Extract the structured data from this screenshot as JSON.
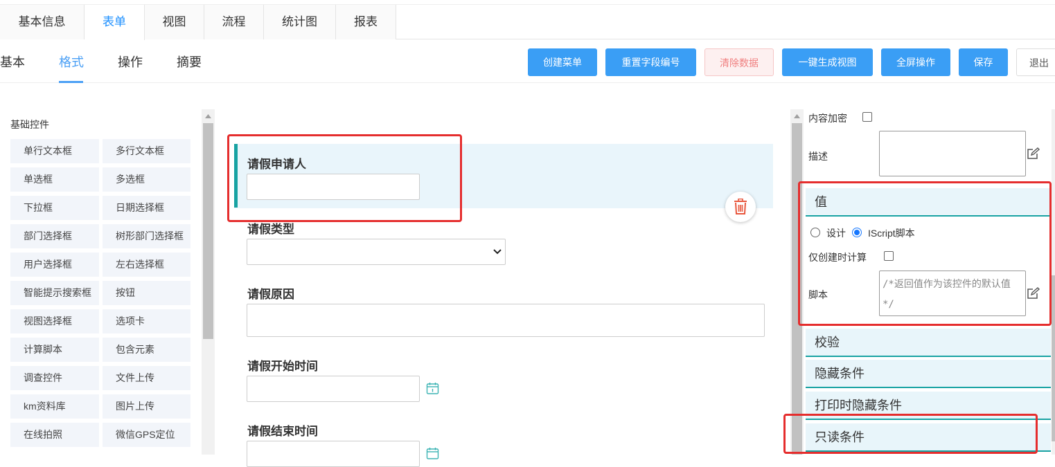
{
  "top_tabs": [
    "基本信息",
    "表单",
    "视图",
    "流程",
    "统计图",
    "报表"
  ],
  "sub_tabs": [
    "基本",
    "格式",
    "操作",
    "摘要"
  ],
  "toolbar": {
    "create_menu": "创建菜单",
    "reset_field_no": "重置字段编号",
    "clear_data": "清除数据",
    "generate_view": "一键生成视图",
    "fullscreen": "全屏操作",
    "save": "保存",
    "exit": "退出"
  },
  "palette": {
    "title": "基础控件",
    "items": [
      "单行文本框",
      "多行文本框",
      "单选框",
      "多选框",
      "下拉框",
      "日期选择框",
      "部门选择框",
      "树形部门选择框",
      "用户选择框",
      "左右选择框",
      "智能提示搜索框",
      "按钮",
      "视图选择框",
      "选项卡",
      "计算脚本",
      "包含元素",
      "调查控件",
      "文件上传",
      "km资料库",
      "图片上传",
      "在线拍照",
      "微信GPS定位"
    ]
  },
  "form": {
    "applicant_label": "请假申请人",
    "type_label": "请假类型",
    "reason_label": "请假原因",
    "start_label": "请假开始时间",
    "end_label": "请假结束时间"
  },
  "props": {
    "encrypt_label": "内容加密",
    "desc_label": "描述",
    "value_section": "值",
    "radio_design": "设计",
    "radio_script": "IScript脚本",
    "create_only": "仅创建时计算",
    "script_label": "脚本",
    "script_placeholder": "/*返回值作为该控件的默认值 */",
    "sections": [
      "校验",
      "隐藏条件",
      "打印时隐藏条件",
      "只读条件"
    ]
  },
  "colors": {
    "primary": "#3a9ef5",
    "teal": "#17a2a2",
    "highlight": "#e52d2d"
  }
}
